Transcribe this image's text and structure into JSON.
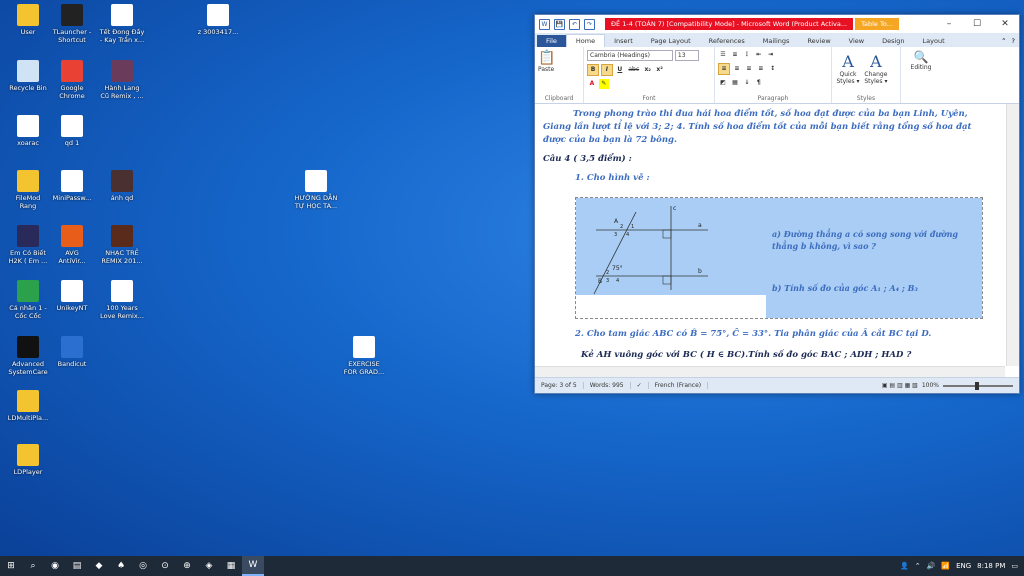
{
  "desktop_icons": [
    {
      "id": "user",
      "label": "User",
      "icon": "user-folder-icon",
      "color": "#f4c430"
    },
    {
      "id": "tlauncher",
      "label": "TLauncher -\nShortcut",
      "icon": "tlauncher-icon",
      "color": "#222222"
    },
    {
      "id": "tetdongday",
      "label": "Tết Đong Đầy\n- Kay Trần x...",
      "icon": "video-file-icon",
      "color": "#ffffff"
    },
    {
      "id": "z3003",
      "label": "z 3003417...",
      "icon": "image-file-icon",
      "color": "#ffffff"
    },
    {
      "id": "recycle",
      "label": "Recycle Bin",
      "icon": "recycle-bin-icon",
      "color": "#cfe3f5"
    },
    {
      "id": "chrome",
      "label": "Google\nChrome",
      "icon": "chrome-icon",
      "color": "#e94235"
    },
    {
      "id": "hanhlang",
      "label": "Hành Lang\nCũ Remix , ...",
      "icon": "video-thumbnail-icon",
      "color": "#6a3b5a"
    },
    {
      "id": "xoarac",
      "label": "xoarac",
      "icon": "image-file-icon",
      "color": "#ffffff"
    },
    {
      "id": "qd1",
      "label": "qd 1",
      "icon": "phone-image-icon",
      "color": "#ffffff"
    },
    {
      "id": "filemod",
      "label": "FileMod\nRang",
      "icon": "folder-icon",
      "color": "#f4c430"
    },
    {
      "id": "minipass",
      "label": "MiniPassw...",
      "icon": "text-file-icon",
      "color": "#ffffff"
    },
    {
      "id": "anhqd",
      "label": "ảnh qd",
      "icon": "image-thumbnail-icon",
      "color": "#4a3030"
    },
    {
      "id": "huongdan",
      "label": "HƯỚNG DẪN\nTỰ HỌC TA...",
      "icon": "word-file-icon",
      "color": "#ffffff"
    },
    {
      "id": "emcobiet",
      "label": "Em Có Biết\nH2K ( Em ...",
      "icon": "video-thumbnail-icon",
      "color": "#2a2a5a"
    },
    {
      "id": "avg",
      "label": "AVG\nAntiVir...",
      "icon": "avg-icon",
      "color": "#e85d1a"
    },
    {
      "id": "nhactre",
      "label": "NHẠC TRẺ\nREMIX 201...",
      "icon": "video-thumbnail-icon",
      "color": "#5a2a1a"
    },
    {
      "id": "canhan",
      "label": "Cá nhân 1 -\nCốc Cốc",
      "icon": "coccoc-icon",
      "color": "#2aa14a"
    },
    {
      "id": "unikey",
      "label": "UnikeyNT",
      "icon": "unikey-icon",
      "color": "#ffffff"
    },
    {
      "id": "100years",
      "label": "100 Years\nLove Remix...",
      "icon": "video-thumbnail-icon",
      "color": "#ffffff"
    },
    {
      "id": "exercise",
      "label": "EXERCISE\nFOR GRAD...",
      "icon": "word-file-icon",
      "color": "#ffffff"
    },
    {
      "id": "advanced",
      "label": "Advanced\nSystemCare",
      "icon": "systemcare-icon",
      "color": "#111111"
    },
    {
      "id": "bandicut",
      "label": "Bandicut",
      "icon": "bandicut-icon",
      "color": "#2b6fd1"
    },
    {
      "id": "ldmulti",
      "label": "LDMultiPla...",
      "icon": "ldmulti-icon",
      "color": "#f4c430"
    },
    {
      "id": "ldplayer",
      "label": "LDPlayer",
      "icon": "ldplayer-icon",
      "color": "#f4c430"
    }
  ],
  "word": {
    "qat": [
      "W",
      "💾",
      "↶",
      "↷"
    ],
    "title": "ĐỀ 1-4 (TOÁN 7) [Compatibility Mode] - Microsoft Word (Product Activa...",
    "context_tab": "Table To...",
    "controls": {
      "minimize": "–",
      "maximize": "☐",
      "close": "✕"
    },
    "tabs": [
      "File",
      "Home",
      "Insert",
      "Page Layout",
      "References",
      "Mailings",
      "Review",
      "View",
      "Design",
      "Layout"
    ],
    "active_tab": "Home",
    "ribbon": {
      "paste": "Paste",
      "font_name": "Cambria (Headings)",
      "font_size": "13",
      "bold": "B",
      "italic": "I",
      "underline": "U",
      "strike": "abc",
      "sub": "x₂",
      "sup": "x²",
      "groups": [
        "Clipboard",
        "Font",
        "Paragraph",
        "Styles",
        "Editing"
      ],
      "quick_styles": "Quick\nStyles ▾",
      "change_styles": "Change\nStyles ▾",
      "editing": "Editing"
    },
    "doc": {
      "para1": "Trong phong trào thi đua hái hoa điểm tốt, số hoa đạt được của ba bạn Linh, Uyên, Giang lần lượt tỉ lệ với 3; 2; 4. Tính số hoa điểm tốt của mỗi bạn biết rằng tổng số hoa đạt được của ba bạn là 72 bông.",
      "cau4": "Câu 4 ( 3,5 điểm) :",
      "item1": "1. Cho hình vẽ :",
      "fig_a": "a) Đường thẳng a có song song với đường thẳng b không, vì sao ?",
      "fig_b": "b) Tính số đo của góc A₁ ; A₄ ; B₃",
      "fig_labels": {
        "A": "A",
        "B": "B",
        "a": "a",
        "b": "b",
        "c": "c",
        "angle": "75°",
        "n1": "1",
        "n2": "2",
        "n3": "3",
        "n4": "4"
      },
      "item2": "2. Cho tam giác ABC có B̂ = 75°, Ĉ = 33°. Tia phân giác của Â cắt BC tại D.",
      "item3": "Kẻ AH vuông góc với BC ( H ∈ BC).Tính số đo góc BAC ; ADH ; HAD ?"
    },
    "status": {
      "page": "Page: 3 of 5",
      "words": "Words: 995",
      "language": "French (France)",
      "zoom": "100%"
    }
  },
  "taskbar": {
    "apps": [
      "⊞",
      "⌕",
      "◉",
      "▤",
      "◆",
      "♠",
      "◎",
      "⊙",
      "⊕",
      "◈",
      "▦",
      "W"
    ],
    "tray": {
      "lang": "ENG",
      "time": "8:18 PM"
    }
  }
}
